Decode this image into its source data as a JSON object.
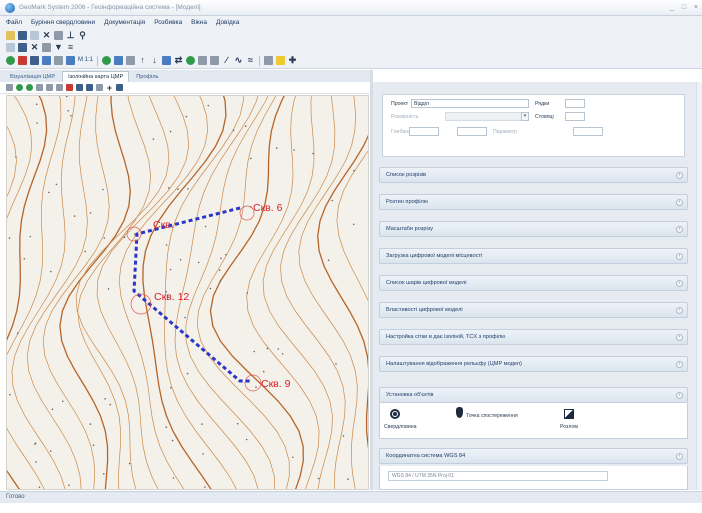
{
  "window": {
    "title": "GeoMark System 2006 - Геоінформаційна система - [Моделі]",
    "controls": [
      "_",
      "□",
      "×"
    ]
  },
  "menu": {
    "items": [
      "Файл",
      "Буріння свердловини",
      "Документація",
      "Розбивка",
      "Вікна",
      "Довідка"
    ]
  },
  "tabs": [
    {
      "label": "Візуалізація ЦМР",
      "active": false
    },
    {
      "label": "Ізолінійна карта ЦМР",
      "active": true
    },
    {
      "label": "Профіль",
      "active": false
    }
  ],
  "map": {
    "wells": [
      {
        "label": "Скв. 6"
      },
      {
        "label": "Скв."
      },
      {
        "label": "Скв. 12"
      },
      {
        "label": "Скв. 9"
      }
    ]
  },
  "project_panel": {
    "project_label": "Проект",
    "project_value": "Відділ",
    "rows_label": "Рядки",
    "cols_label": "Стовпці",
    "depth_label": "Глибина",
    "dim_label": "Розмірність",
    "extra_label": "Параметр"
  },
  "sections": [
    {
      "label": "Список розрізів"
    },
    {
      "label": "Розтин профілю"
    },
    {
      "label": "Масштаби розрізу"
    },
    {
      "label": "Загрузка цифрової моделі місцевості"
    },
    {
      "label": "Список шарів цифрової моделі"
    },
    {
      "label": "Властивості цифрової моделі"
    },
    {
      "label": "Настройка сітки в дає ізоліній, TCX з профілю"
    },
    {
      "label": "Налаштування відображення рельєфу (ЦМР модел)"
    },
    {
      "label": "Установка об'єктів"
    },
    {
      "label": "Координатна система WGS 84"
    }
  ],
  "objects": {
    "items": [
      {
        "label": "Свердловина",
        "icon": "well-icon"
      },
      {
        "label": "Точка спостереження",
        "icon": "point-icon"
      },
      {
        "label": "Розлом",
        "icon": "fault-icon"
      }
    ]
  },
  "coordinate_system": {
    "value": "WGS 84 / UTM 35N Proj-01"
  },
  "status": {
    "text": "Готово"
  },
  "colors": {
    "contour": "#c98a4a",
    "contour_thick": "#b5652a",
    "route": "#2a36c8",
    "well_label": "#d4212a",
    "accent": "#2f69b3"
  }
}
